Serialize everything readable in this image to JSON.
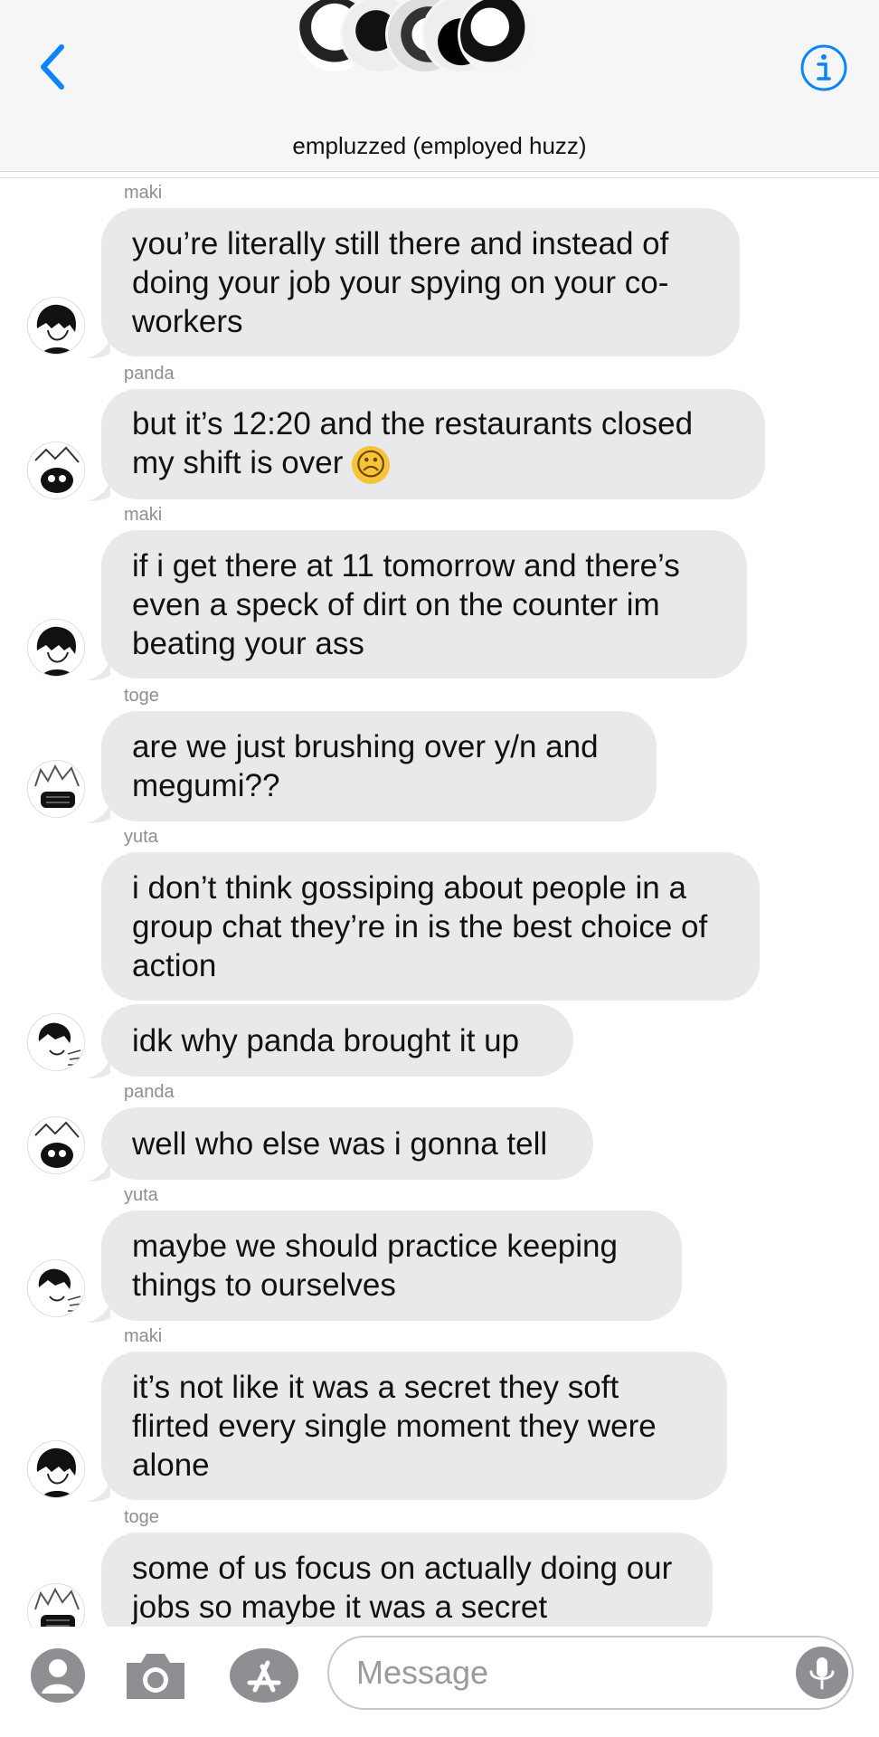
{
  "header": {
    "title": "empluzzed (employed huzz)"
  },
  "messages": [
    {
      "sender": "maki",
      "text": "you’re literally still there and instead of doing your job your spying on your co-workers"
    },
    {
      "sender": "panda",
      "text": "but it’s 12:20 and the restaurants closed my shift is over",
      "emoji": "☹"
    },
    {
      "sender": "maki",
      "text": "if i get there at 11 tomorrow and there’s even a speck of dirt on the counter im beating your ass"
    },
    {
      "sender": "toge",
      "text": "are we just brushing over y/n and megumi??"
    },
    {
      "sender": "yuta",
      "text": "i don’t think gossiping about people in a group chat they’re in is the best choice of action"
    },
    {
      "sender": "",
      "text": "idk why panda brought it up"
    },
    {
      "sender": "panda",
      "text": "well who else was i gonna tell"
    },
    {
      "sender": "yuta",
      "text": "maybe we should practice keeping things to ourselves"
    },
    {
      "sender": "maki",
      "text": "it’s not like it was a secret they soft flirted every single moment they were alone"
    },
    {
      "sender": "toge",
      "text": "some of us focus on actually doing our jobs so maybe it was a secret"
    }
  ],
  "composer": {
    "placeholder": "Message"
  },
  "colors": {
    "accent": "#0a84ff",
    "bubble": "#e9e9eb",
    "sender_label": "#8e8e93"
  },
  "icons": {
    "back": "chevron-left-icon",
    "info": "info-icon",
    "camera": "camera-icon",
    "apps": "app-store-icon",
    "contact": "contact-icon",
    "mic": "mic-icon"
  }
}
